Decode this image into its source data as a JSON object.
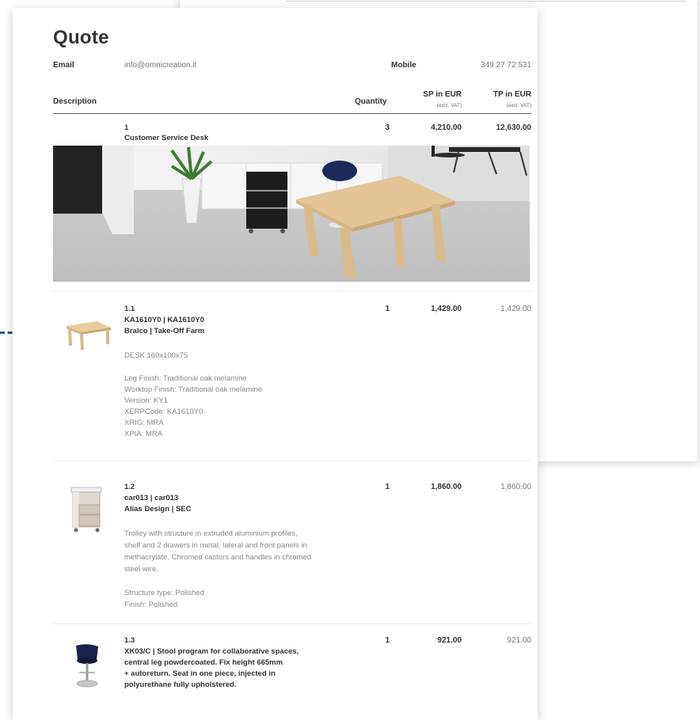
{
  "quote": {
    "title": "Quote",
    "email_label": "Email",
    "email_value": "info@omnicreation.it",
    "mobile_label": "Mobile",
    "mobile_value": "349 27 72 531",
    "columns": {
      "description": "Description",
      "quantity": "Quantity",
      "sp": "SP in EUR",
      "sp_sub": "(excl. VAT)",
      "tp": "TP in EUR",
      "tp_sub": "(excl. VAT)"
    },
    "group": {
      "number": "1",
      "name": "Customer Service Desk",
      "quantity": "3",
      "sp": "4,210.00",
      "tp": "12,630.00"
    },
    "items": [
      {
        "number": "1.1",
        "code": "KA1610Y0 | KA1610Y0",
        "brand": "Bralco | Take-Off Farm",
        "quantity": "1",
        "sp": "1,429.00",
        "tp": "1,429.00",
        "name": "DESK 160x100x75",
        "specs": [
          "Leg Finish: Traditional oak melamine",
          "Worktop Finish: Traditional oak melamine",
          "Version: KY1",
          "XERPCode: KA1610Y0",
          "XRIG: MRA",
          "XPIA: MRA"
        ]
      },
      {
        "number": "1.2",
        "code": "car013 | car013",
        "brand": "Alias Design | SEC",
        "quantity": "1",
        "sp": "1,860.00",
        "tp": "1,860.00",
        "description": [
          "Trolley with structure in extruded aluminium profiles,",
          "shelf and 2 drawers in metal, lateral and front panels in",
          "methacrylate. Chromed castors and handles in chromed",
          "steel wire."
        ],
        "specs": [
          "Structure type: Polished",
          "Finish: Polished"
        ]
      },
      {
        "number": "1.3",
        "code_lines": [
          "XK03/C | Stool program for collaborative spaces,",
          "central leg powdercoated. Fix height 665mm",
          "+ autoreturn. Seat in one piece, injected in",
          "polyurethane fully upholstered."
        ],
        "quantity": "1",
        "sp": "921.00",
        "tp": "921.00"
      }
    ]
  },
  "icons": [
    "render-image",
    "desk-thumbnail",
    "trolley-thumbnail",
    "stool-thumbnail",
    "pointer-dot"
  ],
  "colors": {
    "accent": "#1f5a96",
    "text": "#333333",
    "muted": "#888888"
  }
}
